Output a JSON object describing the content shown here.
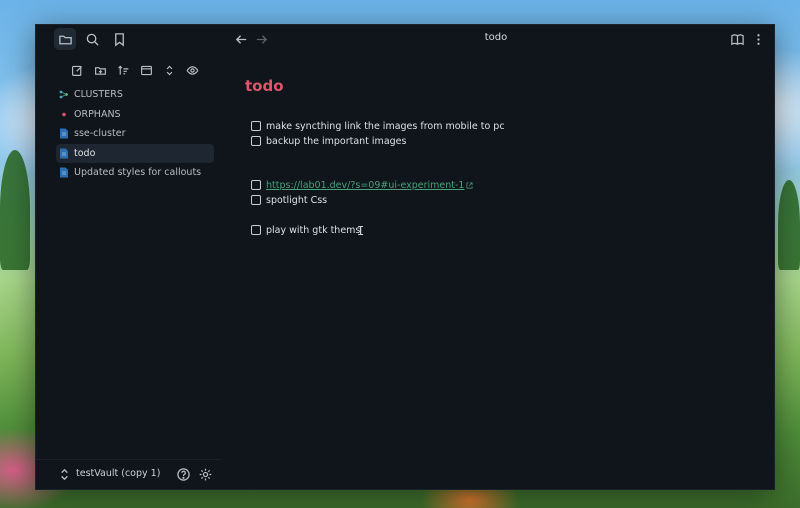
{
  "window": {
    "tab_title": "todo"
  },
  "sidebar": {
    "top_icons": [
      "folder-icon",
      "search-icon",
      "bookmark-icon"
    ],
    "toolbar_icons": [
      "new-note-icon",
      "new-folder-icon",
      "sort-icon",
      "collapse-icon",
      "expand-icon",
      "eye-icon"
    ],
    "items": [
      {
        "label": "CLUSTERS",
        "icon": "cluster-icon",
        "active": false
      },
      {
        "label": "ORPHANS",
        "icon": "orphan-icon",
        "active": false
      },
      {
        "label": "sse-cluster",
        "icon": "file-icon",
        "active": false
      },
      {
        "label": "todo",
        "icon": "file-icon",
        "active": true
      },
      {
        "label": "Updated styles for callouts",
        "icon": "file-icon",
        "active": false
      }
    ],
    "vault": {
      "name": "testVault (copy 1)"
    }
  },
  "document": {
    "title": "todo",
    "tasks": [
      {
        "text": "make syncthing link the images from mobile to pc",
        "checked": false
      },
      {
        "text": "backup the important images",
        "checked": false
      },
      {
        "text": "https://lab01.dev/?s=09#ui-experiment-1",
        "checked": false,
        "is_link": true
      },
      {
        "text": "spotlight Css",
        "checked": false
      },
      {
        "text": "play with gtk thems",
        "checked": false
      }
    ]
  },
  "colors": {
    "title_accent": "#e0556a",
    "link": "#4aa27a",
    "background": "#0f151b"
  }
}
